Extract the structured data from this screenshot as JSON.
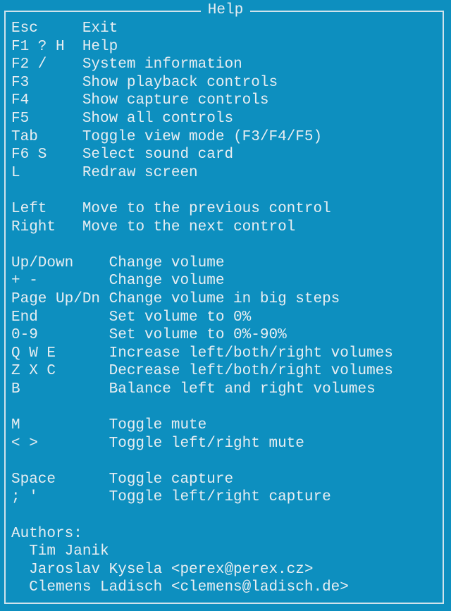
{
  "title": "Help",
  "lines": [
    {
      "key": "Esc",
      "pad": 8,
      "desc": "Exit"
    },
    {
      "key": "F1 ? H",
      "pad": 8,
      "desc": "Help"
    },
    {
      "key": "F2 /",
      "pad": 8,
      "desc": "System information"
    },
    {
      "key": "F3",
      "pad": 8,
      "desc": "Show playback controls"
    },
    {
      "key": "F4",
      "pad": 8,
      "desc": "Show capture controls"
    },
    {
      "key": "F5",
      "pad": 8,
      "desc": "Show all controls"
    },
    {
      "key": "Tab",
      "pad": 8,
      "desc": "Toggle view mode (F3/F4/F5)"
    },
    {
      "key": "F6 S",
      "pad": 8,
      "desc": "Select sound card"
    },
    {
      "key": "L",
      "pad": 8,
      "desc": "Redraw screen"
    },
    {
      "key": "",
      "pad": 0,
      "desc": ""
    },
    {
      "key": "Left",
      "pad": 8,
      "desc": "Move to the previous control"
    },
    {
      "key": "Right",
      "pad": 8,
      "desc": "Move to the next control"
    },
    {
      "key": "",
      "pad": 0,
      "desc": ""
    },
    {
      "key": "Up/Down",
      "pad": 11,
      "desc": "Change volume"
    },
    {
      "key": "+ -",
      "pad": 11,
      "desc": "Change volume"
    },
    {
      "key": "Page Up/Dn",
      "pad": 11,
      "desc": "Change volume in big steps"
    },
    {
      "key": "End",
      "pad": 11,
      "desc": "Set volume to 0%"
    },
    {
      "key": "0-9",
      "pad": 11,
      "desc": "Set volume to 0%-90%"
    },
    {
      "key": "Q W E",
      "pad": 11,
      "desc": "Increase left/both/right volumes"
    },
    {
      "key": "Z X C",
      "pad": 11,
      "desc": "Decrease left/both/right volumes"
    },
    {
      "key": "B",
      "pad": 11,
      "desc": "Balance left and right volumes"
    },
    {
      "key": "",
      "pad": 0,
      "desc": ""
    },
    {
      "key": "M",
      "pad": 11,
      "desc": "Toggle mute"
    },
    {
      "key": "< >",
      "pad": 11,
      "desc": "Toggle left/right mute"
    },
    {
      "key": "",
      "pad": 0,
      "desc": ""
    },
    {
      "key": "Space",
      "pad": 11,
      "desc": "Toggle capture"
    },
    {
      "key": "; '",
      "pad": 11,
      "desc": "Toggle left/right capture"
    },
    {
      "key": "",
      "pad": 0,
      "desc": ""
    },
    {
      "key": "Authors:",
      "pad": 0,
      "desc": ""
    },
    {
      "key": "  Tim Janik",
      "pad": 0,
      "desc": ""
    },
    {
      "key": "  Jaroslav Kysela <perex@perex.cz>",
      "pad": 0,
      "desc": ""
    },
    {
      "key": "  Clemens Ladisch <clemens@ladisch.de>",
      "pad": 0,
      "desc": ""
    }
  ]
}
